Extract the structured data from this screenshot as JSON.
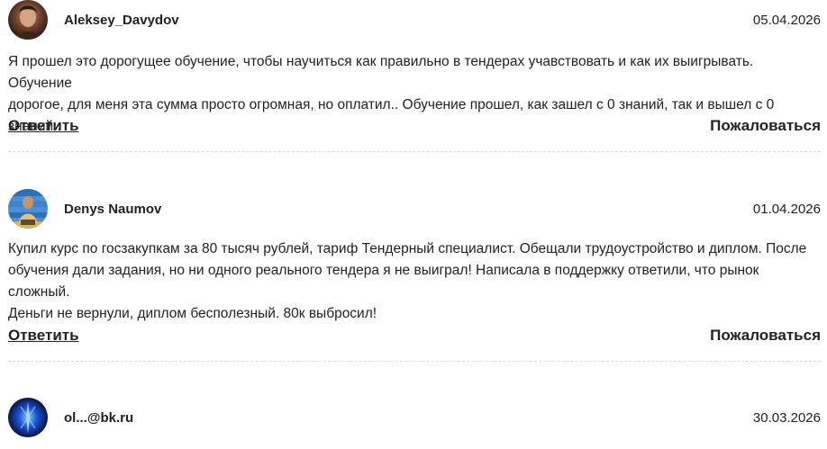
{
  "comments": [
    {
      "author": "Aleksey_Davydov",
      "date": "05.04.2026",
      "lines": [
        "Я прошел это дорогущее обучение, чтобы научиться как правильно в тендерах учавствовать и как их выигрывать. Обучение",
        "дорогое, для меня эта сумма просто огромная, но оплатил.. Обучение прошел, как зашел с 0 знаний, так и вышел с 0 знаний.."
      ],
      "reply_label": "Ответить",
      "complain_label": "Пожаловаться"
    },
    {
      "author": "Denys Naumov",
      "date": "01.04.2026",
      "lines": [
        "Купил курс по госзакупкам за 80 тысяч рублей, тариф Тендерный специалист. Обещали трудоустройство и диплом. После",
        "обучения дали задания, но ни одного реального тендера я не выиграл! Написала в поддержку ответили, что рынок сложный.",
        "Деньги не вернули, диплом бесполезный. 80к выбросил!"
      ],
      "reply_label": "Ответить",
      "complain_label": "Пожаловаться"
    },
    {
      "author": "ol...@bk.ru",
      "date": "30.03.2026"
    }
  ]
}
